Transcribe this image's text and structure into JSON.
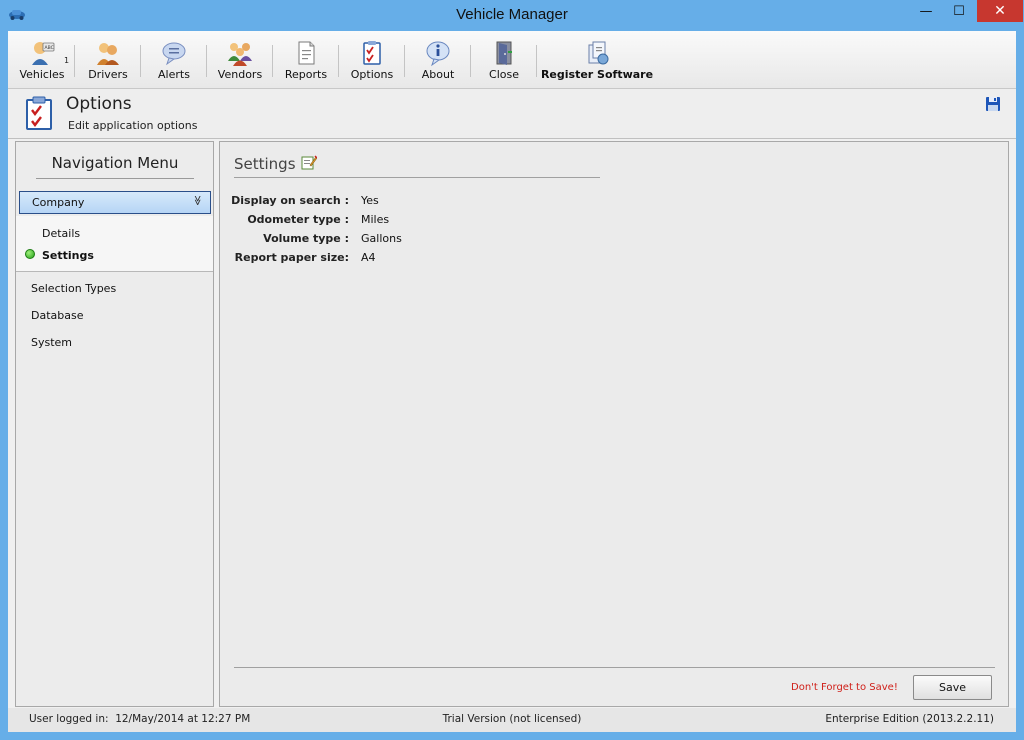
{
  "window": {
    "title": "Vehicle Manager",
    "minimize_glyph": "—",
    "maximize_glyph": "☐",
    "close_glyph": "✕"
  },
  "toolbar": {
    "items": [
      {
        "label": "Vehicles",
        "icon": "vehicles-icon",
        "badge": "1"
      },
      {
        "label": "Drivers",
        "icon": "drivers-icon"
      },
      {
        "label": "Alerts",
        "icon": "alerts-icon"
      },
      {
        "label": "Vendors",
        "icon": "vendors-icon"
      },
      {
        "label": "Reports",
        "icon": "reports-icon"
      },
      {
        "label": "Options",
        "icon": "options-icon"
      },
      {
        "label": "About",
        "icon": "about-icon"
      },
      {
        "label": "Close",
        "icon": "close-door-icon"
      },
      {
        "label": "Register Software",
        "icon": "register-software-icon"
      }
    ]
  },
  "header": {
    "title": "Options",
    "subtitle": "Edit application options",
    "icon": "options-checklist-icon",
    "save_icon": "save-disk-icon"
  },
  "nav": {
    "title": "Navigation Menu",
    "group": {
      "label": "Company",
      "chevron": "≫"
    },
    "sub_items": [
      {
        "label": "Details",
        "active": false
      },
      {
        "label": "Settings",
        "active": true
      }
    ],
    "items": [
      {
        "label": "Selection Types"
      },
      {
        "label": "Database"
      },
      {
        "label": "System"
      }
    ]
  },
  "content": {
    "title": "Settings",
    "properties": [
      {
        "label": "Display on search :",
        "value": "Yes"
      },
      {
        "label": "Odometer type :",
        "value": "Miles"
      },
      {
        "label": "Volume type :",
        "value": "Gallons"
      },
      {
        "label": "Report paper size:",
        "value": "A4"
      }
    ],
    "reminder": "Don't Forget to Save!",
    "save_label": "Save"
  },
  "status": {
    "user_logged_in": "User logged in:  12/May/2014 at 12:27 PM",
    "license": "Trial Version (not licensed)",
    "edition": "Enterprise Edition (2013.2.2.11)"
  },
  "colors": {
    "frame": "#66aee8",
    "close_button": "#c7372f",
    "reminder_text": "#d0201a",
    "active_dot": "#26a01a",
    "selected_group": "#b6d5f5"
  }
}
